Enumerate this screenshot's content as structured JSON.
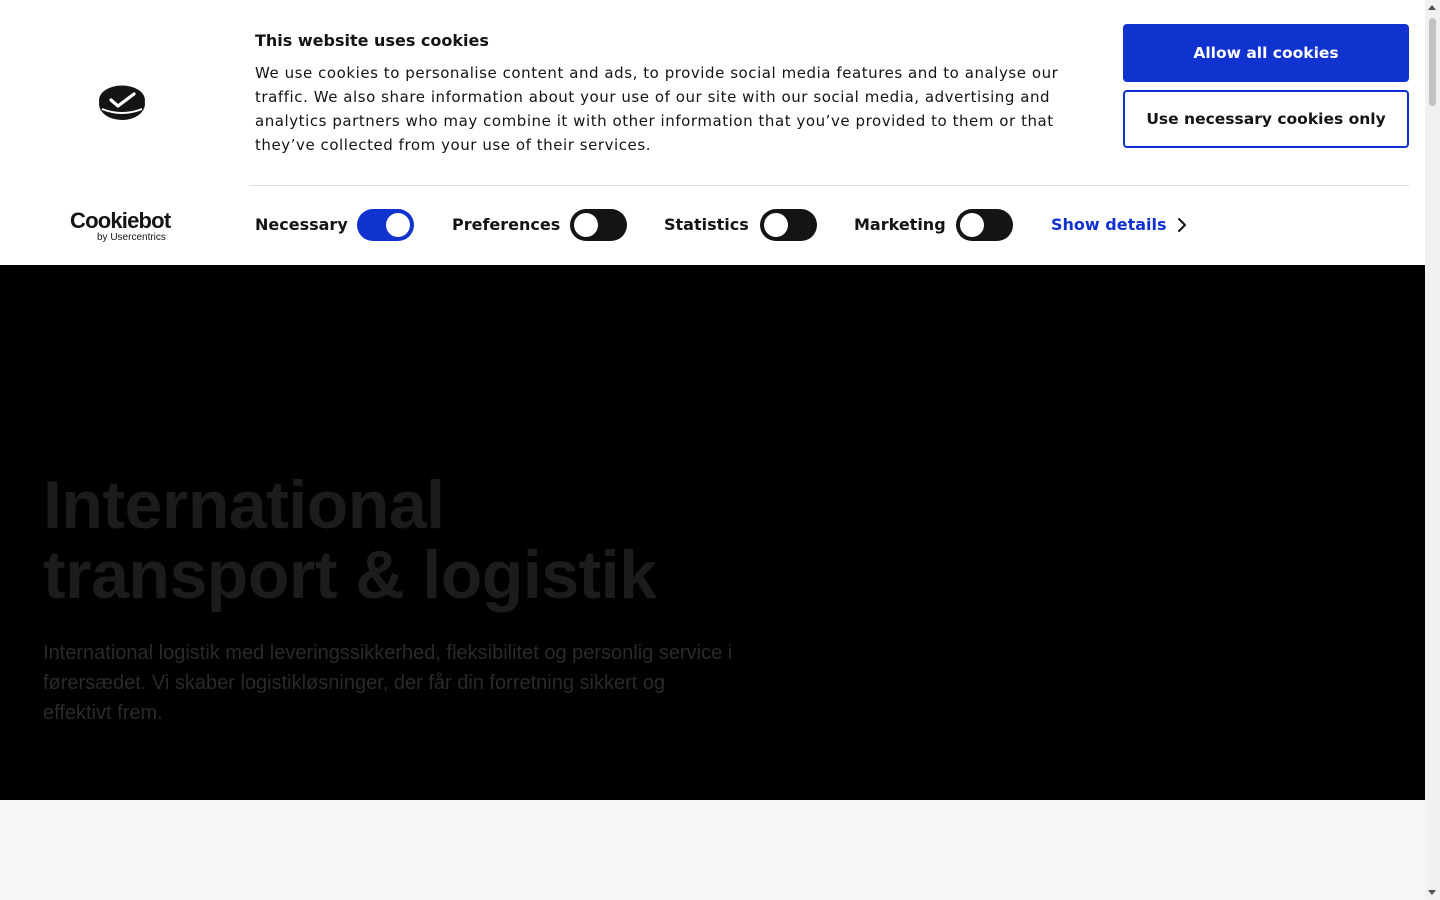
{
  "colors": {
    "accent": "#1032cf",
    "banner_bg": "#ffffff",
    "hero_bg": "#000000",
    "page_bg": "#f4f7f6"
  },
  "cookie_banner": {
    "title": "This website uses cookies",
    "description": "We use cookies to personalise content and ads, to provide social media features and to analyse our traffic. We also share information about your use of our site with our social media, advertising and analytics partners who may combine it with other information that you’ve provided to them or that they’ve collected from your use of their services.",
    "allow_all_label": "Allow all cookies",
    "necessary_only_label": "Use necessary cookies only",
    "brand": {
      "name": "Cookiebot",
      "byline": "by Usercentrics"
    },
    "categories": [
      {
        "label": "Necessary",
        "enabled": true
      },
      {
        "label": "Preferences",
        "enabled": false
      },
      {
        "label": "Statistics",
        "enabled": false
      },
      {
        "label": "Marketing",
        "enabled": false
      }
    ],
    "show_details_label": "Show details",
    "icons": {
      "logo": "site-logo-icon",
      "details": "chevron-right-icon"
    }
  },
  "hero": {
    "title": "International\ntransport & logistik",
    "text": "International logistik med leveringssikkerhed, fleksibilitet og personlig service i førersædet. Vi skaber logistikløsninger, der får din forretning sikkert og effektivt frem."
  }
}
